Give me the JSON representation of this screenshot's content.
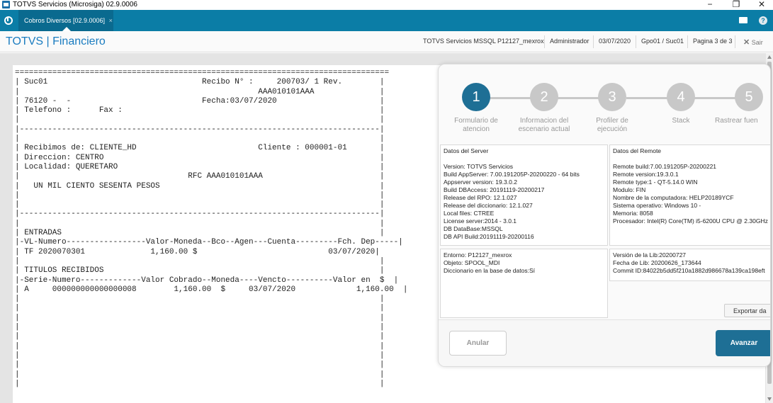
{
  "window": {
    "title": "TOTVS Servicios (Microsiga) 02.9.0006",
    "minimize": "−",
    "restore": "❐",
    "close": "✕"
  },
  "tabbar": {
    "active_tab": "Cobros Diversos [02.9.0006]",
    "tab_close": "×",
    "help": "?"
  },
  "header": {
    "brand": "TOTVS | Financiero",
    "environment": "TOTVS Servicios MSSQL P12127_mexrox",
    "user": "Administrador",
    "date": "03/07/2020",
    "branch": "Gpo01 / Suc01",
    "page": "Pagina 3 de 3",
    "exit": "Sair"
  },
  "report": {
    "lines": [
      "================================================================================",
      "| Suc01                                 Recibo N° :     200703/ 1 Rev.        |",
      "|                                                   AAA010101AAA              |",
      "| 76120 -  -                            Fecha:03/07/2020                      |",
      "| Telefono :      Fax :                                                       |",
      "|                                                                             |",
      "|-----------------------------------------------------------------------------|",
      "|                                                                             |",
      "| Recibimos de: CLIENTE_HD                          Cliente : 000001-01       |",
      "| Direccion: CENTRO                                                           |",
      "| Localidad: QUERETARO                                                        |",
      "|                                    RFC AAA010101AAA                         |",
      "|   UN MIL CIENTO SESENTA PESOS                                               |",
      "|                                                                             |",
      "|                                                                             |",
      "|-----------------------------------------------------------------------------|",
      "|                                                                             |",
      "| ENTRADAS                                                                    |",
      "|-VL-Numero-----------------Valor-Moneda--Bco--Agen---Cuenta---------Fch. Dep-----|",
      "| TF 2020070301              1,160.00 $                            03/07/2020|",
      "|                                                                             |",
      "| TITULOS RECIBIDOS                                                           |",
      "|-Serie-Numero-------------Valor Cobrado--Moneda----Vencto----------Valor en  $  |",
      "| A     000000000000000008        1,160.00  $     03/07/2020             1,160.00  |",
      "|                                                                             |",
      "|                                                                             |",
      "|                                                                             |",
      "|                                                                             |",
      "|                                                                             |",
      "|                                                                             |",
      "|                                                                             |",
      "|                                                                             |",
      "|                                                                             |",
      "|                                                                             |"
    ]
  },
  "wizard": {
    "steps": [
      {
        "number": "1",
        "label": "Formulario de atencion"
      },
      {
        "number": "2",
        "label": "Informacion del escenario actual"
      },
      {
        "number": "3",
        "label": "Profiler de ejecución"
      },
      {
        "number": "4",
        "label": "Stack"
      },
      {
        "number": "5",
        "label": "Rastrear fuen"
      }
    ],
    "server_box": {
      "title": "Datos del Server",
      "lines": [
        "Version: TOTVS Servicios",
        "Build AppServer: 7.00.191205P-20200220 - 64 bits",
        "Appserver version: 19.3.0.2",
        "Build DBAccess: 20191119-20200217",
        "Release del RPO:  12.1.027",
        "Release del diccionario: 12.1.027",
        "Local files: CTREE",
        "License server:2014 - 3.0.1",
        "DB DataBase:MSSQL",
        "DB API Build:20191119-20200116"
      ]
    },
    "remote_box": {
      "title": "Datos del Remote",
      "lines": [
        "Remote build:7.00.191205P-20200221",
        "Remote version:19.3.0.1",
        "Remote type:1 - QT-5.14.0 WIN",
        "Modulo: FIN",
        "Nombre de la computadora: HELP20189YCF",
        "Sistema operativo: Windows 10 -",
        "Memoria: 8058",
        "Procesador: Intel(R) Core(TM) i5-6200U CPU @ 2.30GHz"
      ]
    },
    "env_box": {
      "lines": [
        "Entorno: P12127_mexrox",
        "Objeto: SPOOL_MDI",
        "Diccionario en la base de datos:Sí"
      ]
    },
    "lib_box": {
      "lines": [
        "Versión de la Lib:20200727",
        "Fecha de Lib: 20200626_173644",
        "Commit ID:84022b5dd5f210a1882d986678a139ca198eft"
      ]
    },
    "export_label": "Exportar da",
    "cancel_label": "Anular",
    "next_label": "Avanzar"
  },
  "colors": {
    "tabbar": "#0b7da6",
    "brand": "#1a7cc0",
    "step_active": "#1e6f95",
    "step_inactive": "#c8c8c8"
  }
}
